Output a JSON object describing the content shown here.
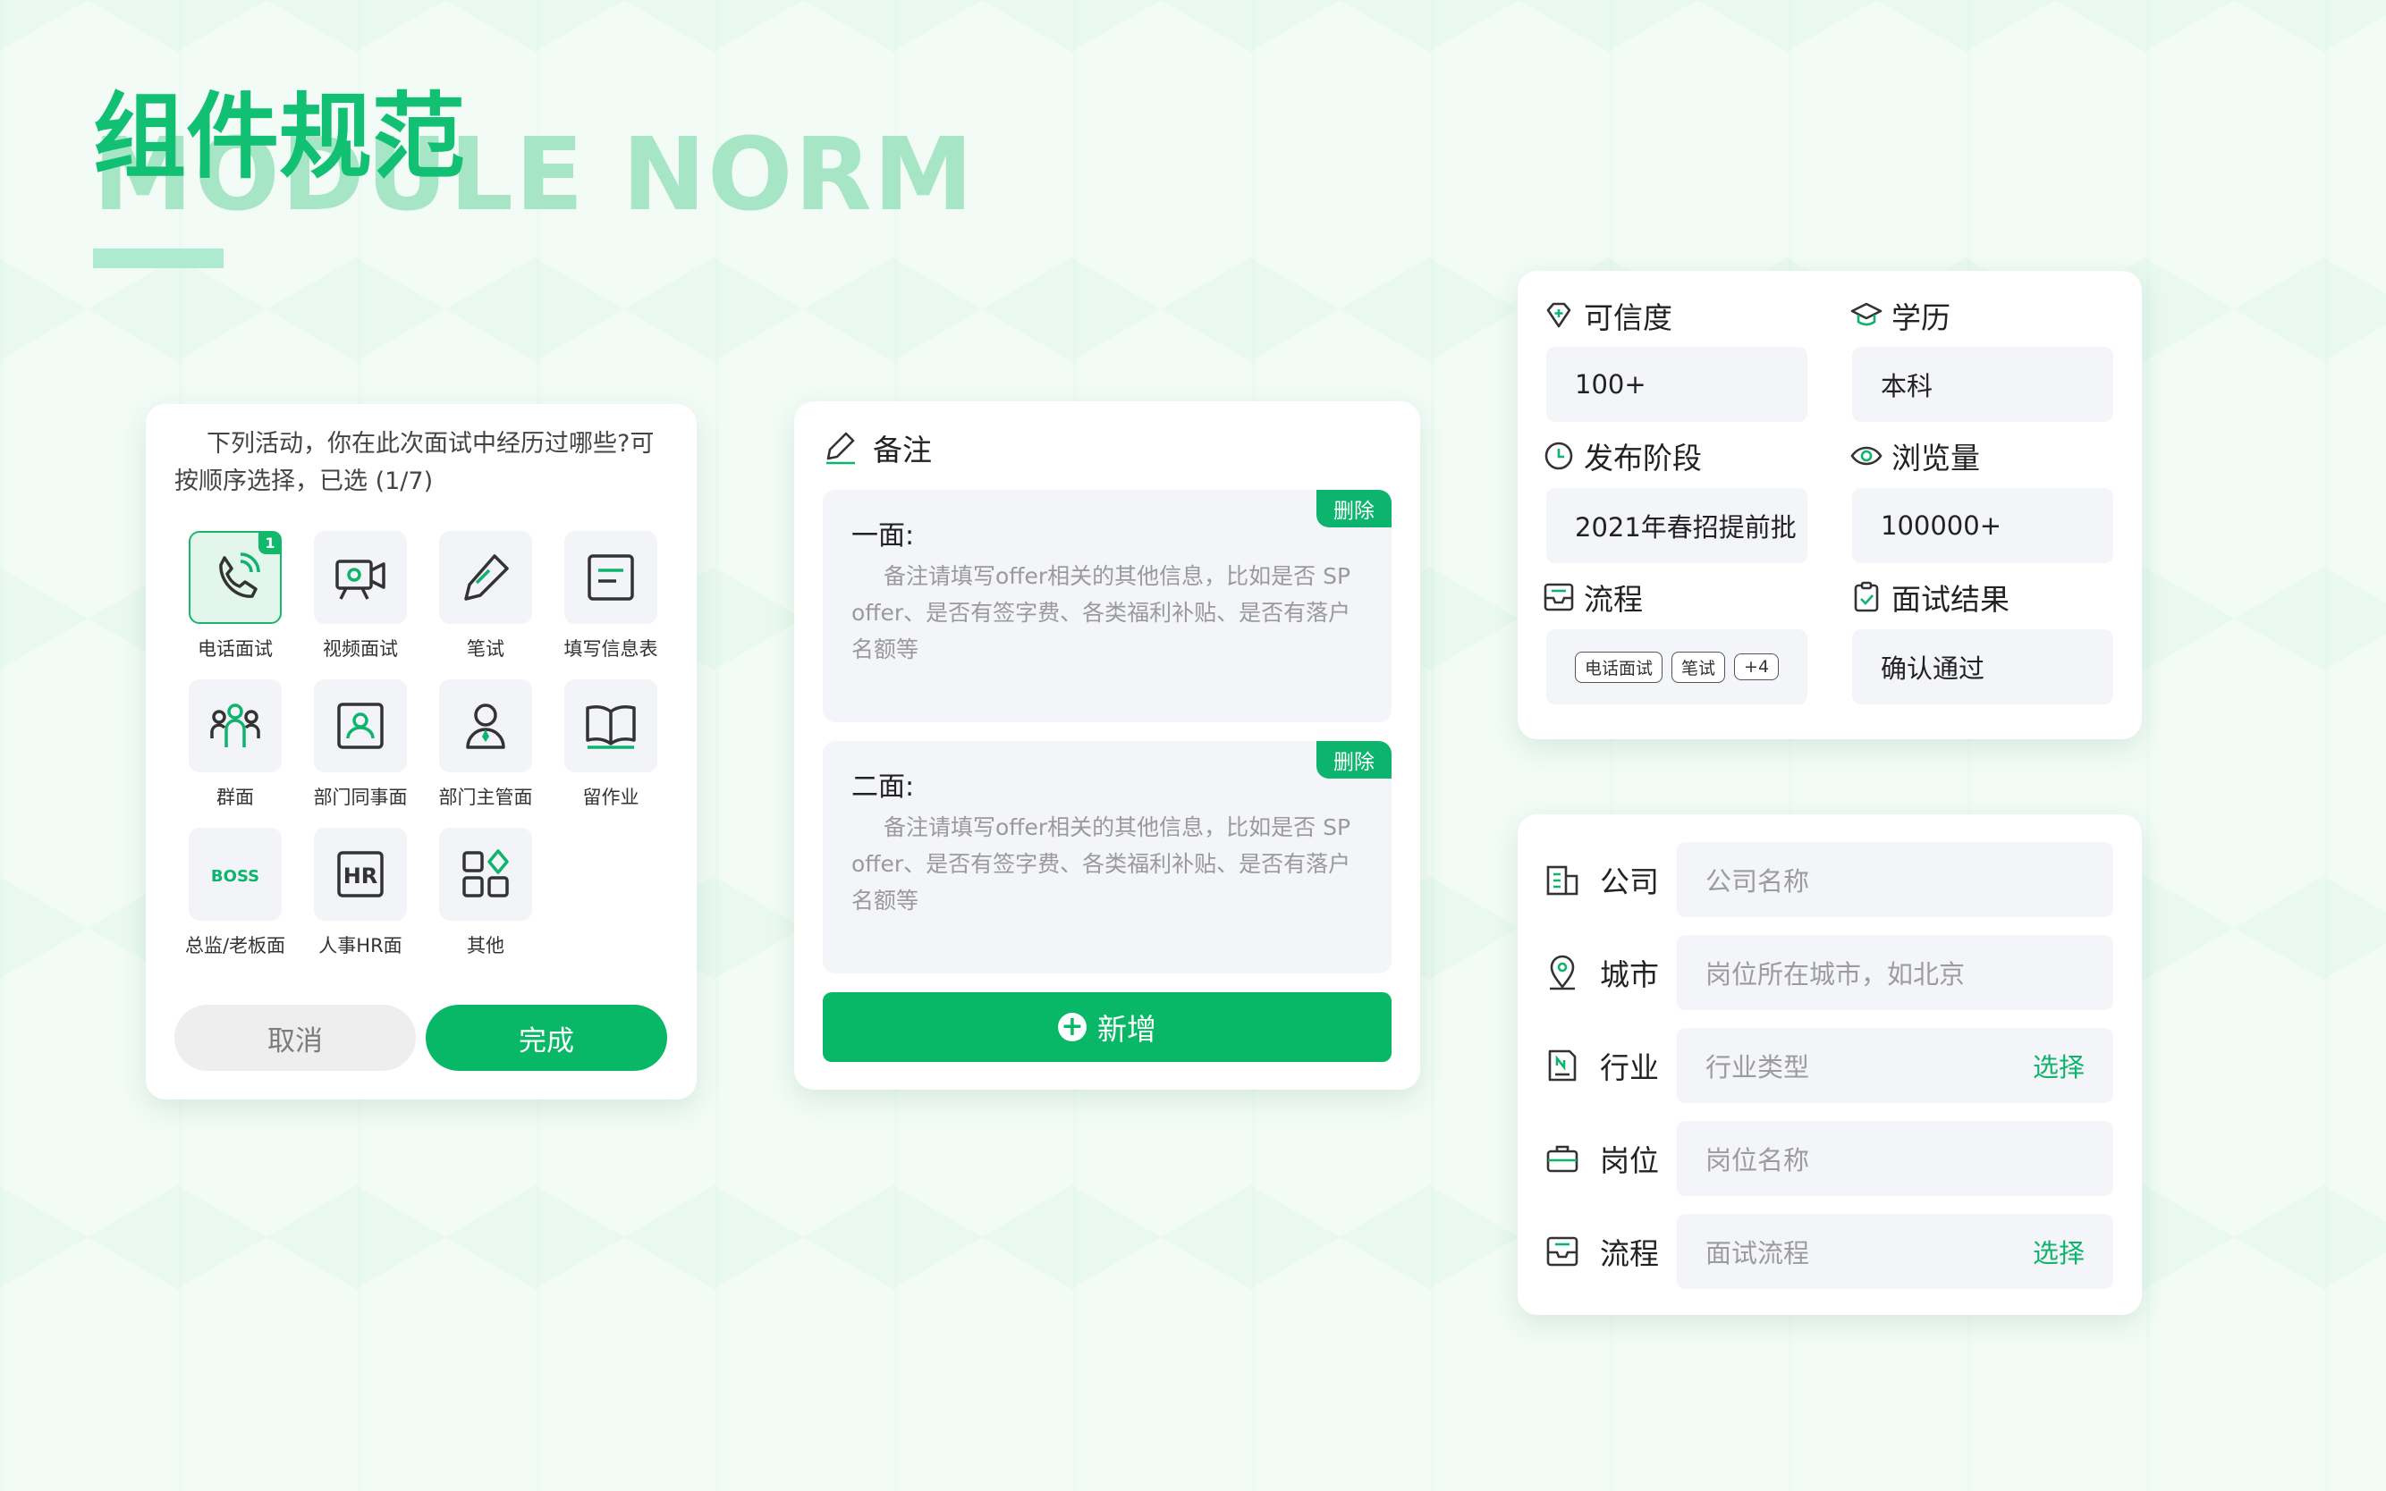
{
  "header": {
    "title": "组件规范",
    "subtitle": "MODULE NORM"
  },
  "activity_picker": {
    "question": "下列活动，你在此次面试中经历过哪些?可按顺序选择，已选 (1/7)",
    "options": [
      {
        "label": "电话面试",
        "icon": "phone-icon",
        "selected": true,
        "order": "1"
      },
      {
        "label": "视频面试",
        "icon": "video-icon",
        "selected": false
      },
      {
        "label": "笔试",
        "icon": "pencil-icon",
        "selected": false
      },
      {
        "label": "填写信息表",
        "icon": "form-icon",
        "selected": false
      },
      {
        "label": "群面",
        "icon": "group-icon",
        "selected": false
      },
      {
        "label": "部门同事面",
        "icon": "colleague-icon",
        "selected": false
      },
      {
        "label": "部门主管面",
        "icon": "manager-icon",
        "selected": false
      },
      {
        "label": "留作业",
        "icon": "book-icon",
        "selected": false
      },
      {
        "label": "总监/老板面",
        "icon": "boss-icon",
        "selected": false,
        "icon_text": "BOSS"
      },
      {
        "label": "人事HR面",
        "icon": "hr-icon",
        "selected": false,
        "icon_text": "HR"
      },
      {
        "label": "其他",
        "icon": "grid-icon",
        "selected": false
      }
    ],
    "cancel_label": "取消",
    "done_label": "完成"
  },
  "notes": {
    "title": "备注",
    "items": [
      {
        "title": "一面:",
        "body": "备注请填写offer相关的其他信息，比如是否 SP offer、是否有签字费、各类福利补贴、是否有落户名额等",
        "delete_label": "删除"
      },
      {
        "title": "二面:",
        "body": "备注请填写offer相关的其他信息，比如是否 SP offer、是否有签字费、各类福利补贴、是否有落户名额等",
        "delete_label": "删除"
      }
    ],
    "add_label": "新增"
  },
  "info": {
    "credibility": {
      "label": "可信度",
      "value": "100+"
    },
    "education": {
      "label": "学历",
      "value": "本科"
    },
    "stage": {
      "label": "发布阶段",
      "value": "2021年春招提前批"
    },
    "views": {
      "label": "浏览量",
      "value": "100000+"
    },
    "process": {
      "label": "流程",
      "tags": [
        "电话面试",
        "笔试",
        "+4"
      ]
    },
    "result": {
      "label": "面试结果",
      "value": "确认通过"
    }
  },
  "form": {
    "rows": [
      {
        "label": "公司",
        "placeholder": "公司名称",
        "icon": "building-icon"
      },
      {
        "label": "城市",
        "placeholder": "岗位所在城市，如北京",
        "icon": "location-icon"
      },
      {
        "label": "行业",
        "placeholder": "行业类型",
        "icon": "industry-icon",
        "action": "选择"
      },
      {
        "label": "岗位",
        "placeholder": "岗位名称",
        "icon": "briefcase-icon"
      },
      {
        "label": "流程",
        "placeholder": "面试流程",
        "icon": "process-icon",
        "action": "选择"
      }
    ]
  },
  "colors": {
    "accent": "#08b866",
    "accent_light": "#a6e6c6",
    "field_bg": "#f4f5f8"
  }
}
